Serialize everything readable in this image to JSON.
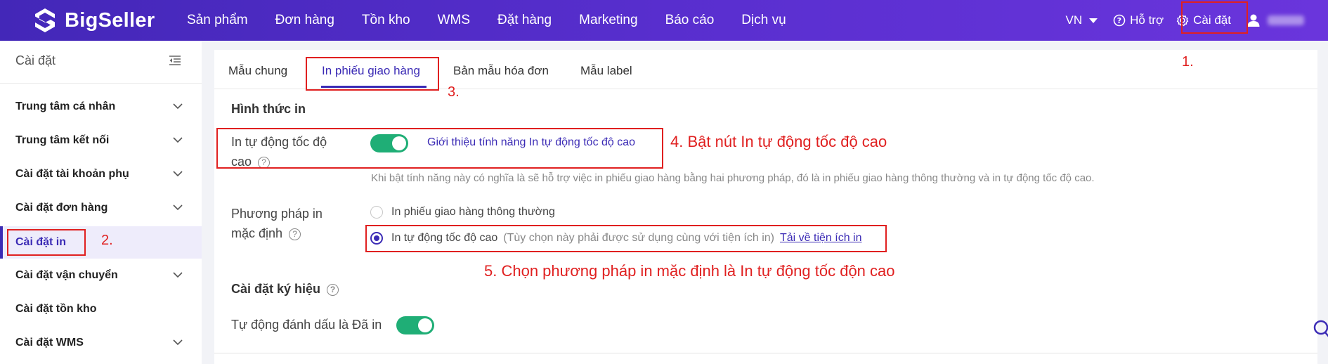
{
  "header": {
    "logo_text": "BigSeller",
    "nav": [
      "Sản phẩm",
      "Đơn hàng",
      "Tồn kho",
      "WMS",
      "Đặt hàng",
      "Marketing",
      "Báo cáo",
      "Dịch vụ"
    ],
    "lang": "VN",
    "help": "Hỗ trợ",
    "settings": "Cài đặt"
  },
  "sidebar": {
    "title": "Cài đặt",
    "items": [
      {
        "label": "Trung tâm cá nhân",
        "has_chevron": true
      },
      {
        "label": "Trung tâm kết nối",
        "has_chevron": true
      },
      {
        "label": "Cài đặt tài khoản phụ",
        "has_chevron": true
      },
      {
        "label": "Cài đặt đơn hàng",
        "has_chevron": true
      },
      {
        "label": "Cài đặt in",
        "active": true
      },
      {
        "label": "Cài đặt vận chuyển",
        "has_chevron": true
      },
      {
        "label": "Cài đặt tồn kho"
      },
      {
        "label": "Cài đặt WMS",
        "has_chevron": true
      }
    ]
  },
  "tabs": [
    "Mẫu chung",
    "In phiếu giao hàng",
    "Bản mẫu hóa đơn",
    "Mẫu label"
  ],
  "active_tab": 1,
  "print_section": {
    "title": "Hình thức in",
    "auto_label": "In tự động tốc độ cao",
    "auto_enabled": true,
    "intro_link": "Giới thiệu tính năng In tự động tốc độ cao",
    "description": "Khi bật tính năng này có nghĩa là sẽ hỗ trợ việc in phiếu giao hàng bằng hai phương pháp, đó là in phiếu giao hàng thông thường và in tự động tốc độ cao.",
    "method_label": "Phương pháp in mặc định",
    "options": [
      {
        "label": "In phiếu giao hàng thông thường",
        "checked": false
      },
      {
        "label": "In tự động tốc độ cao",
        "hint": "(Tùy chọn này phải được sử dụng cùng với tiện ích in)",
        "link": "Tải về tiện ích in",
        "checked": true
      }
    ]
  },
  "symbol_section": {
    "title": "Cài đặt ký hiệu",
    "auto_mark_label": "Tự động đánh dấu là Đã in",
    "auto_mark_enabled": true
  },
  "annotations": {
    "a1": "1.",
    "a2": "2.",
    "a3": "3.",
    "a4": "4. Bật nút In tự động tốc độ cao",
    "a5": "5. Chọn phương pháp in mặc định là In tự động tốc độn cao"
  },
  "colors": {
    "header_start": "#4327b8",
    "header_end": "#6a35dc",
    "accent": "#3b2bb5",
    "toggle_on": "#1fae76",
    "annotation": "#e02020"
  }
}
